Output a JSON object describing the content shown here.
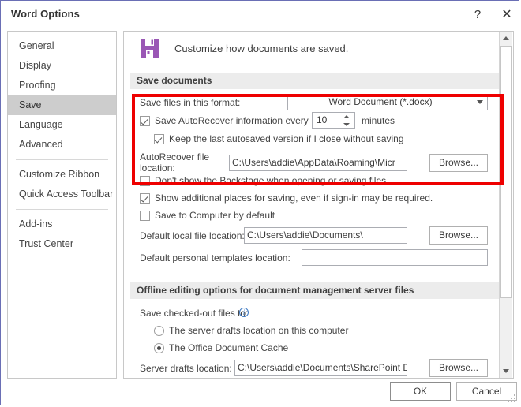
{
  "window": {
    "title": "Word Options",
    "help_label": "?",
    "close_label": "✕"
  },
  "sidebar": {
    "items": [
      {
        "label": "General",
        "selected": false,
        "sep_after": false
      },
      {
        "label": "Display",
        "selected": false,
        "sep_after": false
      },
      {
        "label": "Proofing",
        "selected": false,
        "sep_after": false
      },
      {
        "label": "Save",
        "selected": true,
        "sep_after": false
      },
      {
        "label": "Language",
        "selected": false,
        "sep_after": false
      },
      {
        "label": "Advanced",
        "selected": false,
        "sep_after": true
      },
      {
        "label": "Customize Ribbon",
        "selected": false,
        "sep_after": false
      },
      {
        "label": "Quick Access Toolbar",
        "selected": false,
        "sep_after": true
      },
      {
        "label": "Add-ins",
        "selected": false,
        "sep_after": false
      },
      {
        "label": "Trust Center",
        "selected": false,
        "sep_after": false
      }
    ]
  },
  "panel": {
    "header": "Customize how documents are saved.",
    "save_icon_name": "floppy-disk-icon",
    "save_icon_color": "#9a57b5",
    "sections": {
      "save_documents": {
        "title": "Save documents",
        "format_label": "Save files in this format:",
        "format_value": "Word Document (*.docx)",
        "autorecover_label_pre": "Save ",
        "autorecover_label_u": "A",
        "autorecover_label_post": "utoRecover information every",
        "autorecover_checked": true,
        "autorecover_minutes": "10",
        "minutes_label": "minutes",
        "keep_last_label": "Keep the last autosaved version if I close without saving",
        "keep_last_checked": true,
        "autorecover_loc_label_line1": "AutoRecover file",
        "autorecover_loc_label_line2": "location:",
        "autorecover_loc_value": "C:\\Users\\addie\\AppData\\Roaming\\Micr",
        "autorecover_browse": "Browse...",
        "dont_show_backstage_label": "Don't show the Backstage when opening or saving files",
        "dont_show_backstage_checked": false,
        "show_additional_places_label": "Show additional places for saving, even if sign-in may be required.",
        "show_additional_places_checked": true,
        "save_to_computer_label": "Save to Computer by default",
        "save_to_computer_checked": false,
        "default_local_label": "Default local file location:",
        "default_local_value": "C:\\Users\\addie\\Documents\\",
        "default_local_browse": "Browse...",
        "default_templates_label": "Default personal templates location:",
        "default_templates_value": ""
      },
      "offline_editing": {
        "title": "Offline editing options for document management server files",
        "checked_out_label": "Save checked-out files to:",
        "info_icon_name": "info-icon",
        "radio_server_drafts": "The server drafts location on this computer",
        "radio_office_cache": "The Office Document Cache",
        "selected_radio": "office_cache",
        "server_drafts_label": "Server drafts location:",
        "server_drafts_value": "C:\\Users\\addie\\Documents\\SharePoint Draf",
        "server_drafts_browse": "Browse..."
      }
    }
  },
  "footer": {
    "ok_label": "OK",
    "cancel_label": "Cancel"
  },
  "highlight": {
    "color": "#ee0000"
  },
  "scrollbar": {
    "up_arrow": "scroll-up",
    "down_arrow": "scroll-down"
  }
}
